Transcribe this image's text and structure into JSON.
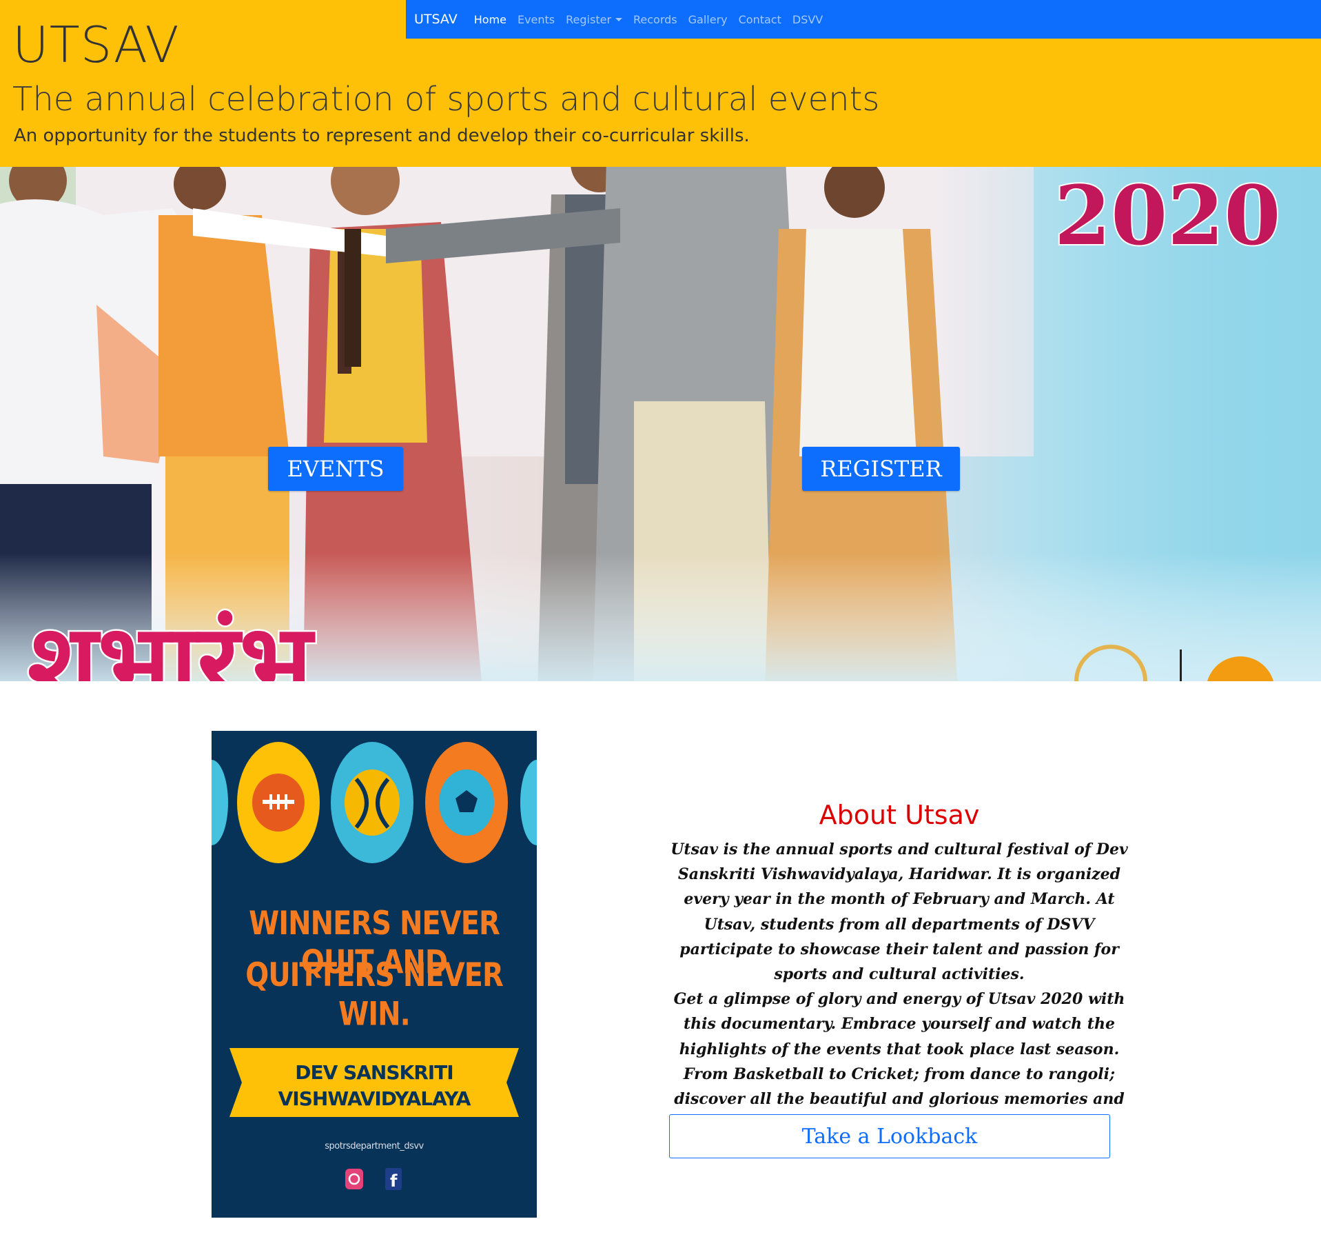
{
  "header": {
    "title": "UTSAV",
    "tagline": "The annual celebration of sports and cultural events",
    "subtitle": "An opportunity for the students to represent and develop their co-curricular skills."
  },
  "navbar": {
    "brand": "UTSAV",
    "links": [
      {
        "label": "Home",
        "active": true
      },
      {
        "label": "Events",
        "active": false
      },
      {
        "label": "Register",
        "active": false,
        "dropdown": true
      },
      {
        "label": "Records",
        "active": false
      },
      {
        "label": "Gallery",
        "active": false
      },
      {
        "label": "Contact",
        "active": false
      },
      {
        "label": "DSVV",
        "active": false
      }
    ]
  },
  "hero": {
    "year_text": "2020",
    "banner_text": "शुभारंभ",
    "events_button": "EVENTS",
    "register_button": "REGISTER"
  },
  "poster": {
    "slogan_line1": "WINNERS NEVER QUIT AND",
    "slogan_line2": "QUITTERS NEVER WIN.",
    "university_line1": "DEV SANSKRITI",
    "university_line2": "VISHWAVIDYALAYA",
    "handle": "spotrsdepartment_dsvv",
    "icons": [
      "football-icon",
      "tennis-ball-icon",
      "soccer-ball-icon",
      "instagram-icon",
      "facebook-icon"
    ]
  },
  "about": {
    "heading": "About Utsav",
    "paragraph1": "Utsav is the annual sports and cultural festival of Dev Sanskriti Vishwavidyalaya, Haridwar. It is organized every year in the month of February and March. At Utsav, students from all departments of DSVV participate to showcase their talent and passion for sports and cultural activities.",
    "paragraph2": "Get a glimpse of glory and energy of Utsav 2020 with this documentary. Embrace yourself and watch the highlights of the events that took place last season. From Basketball to Cricket; from dance to rangoli; discover all the beautiful and glorious memories and fill your hearts with curiosity.",
    "button_label": "Take a Lookback"
  },
  "colors": {
    "header_yellow": "#ffc107",
    "nav_blue": "#0d6efd",
    "heading_red": "#dd0000",
    "poster_navy": "#083358",
    "poster_orange": "#f47b20",
    "banner_pink": "#c2185b"
  }
}
